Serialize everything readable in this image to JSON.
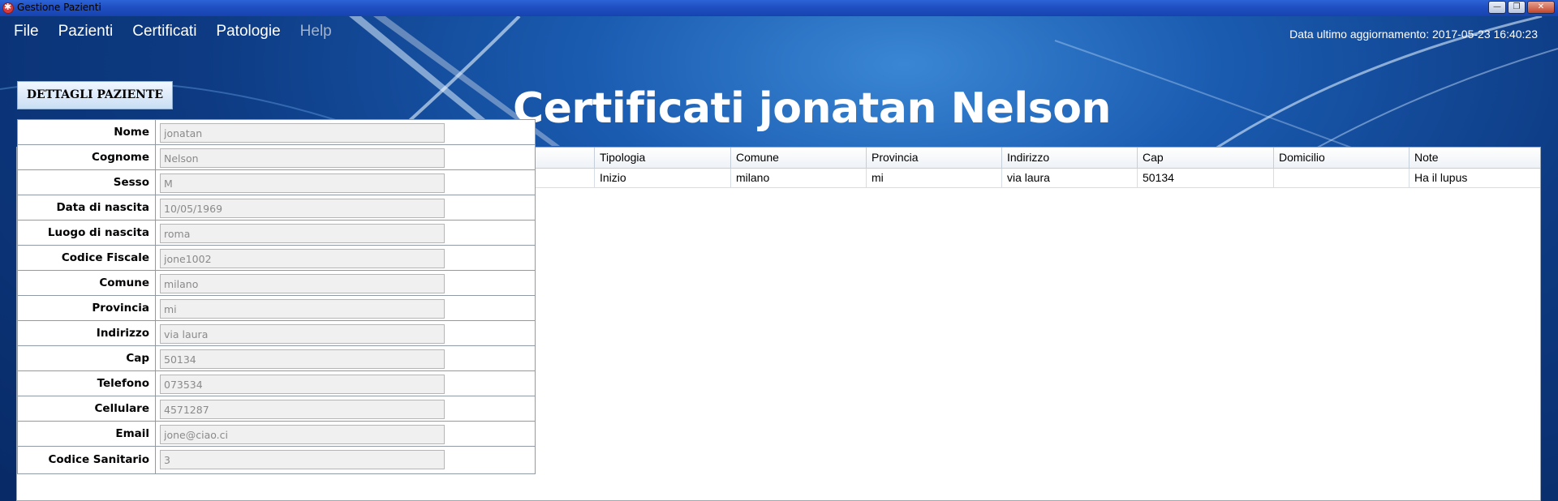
{
  "window": {
    "title": "Gestione Pazienti",
    "buttons": [
      "—",
      "❐",
      "✕"
    ]
  },
  "menu": {
    "items": [
      "File",
      "Pazienti",
      "Certificati",
      "Patologie",
      "Help"
    ]
  },
  "header": {
    "update_label": "Data ultimo aggiornamento: 2017-05-23 16:40:23",
    "page_title": "Certificati jonatan Nelson"
  },
  "details_button": "DETTAGLI PAZIENTE",
  "patient_form": {
    "fields": [
      {
        "label": "Nome",
        "value": "jonatan"
      },
      {
        "label": "Cognome",
        "value": "Nelson"
      },
      {
        "label": "Sesso",
        "value": "M"
      },
      {
        "label": "Data di nascita",
        "value": "10/05/1969"
      },
      {
        "label": "Luogo di nascita",
        "value": "roma"
      },
      {
        "label": "Codice Fiscale",
        "value": "jone1002"
      },
      {
        "label": "Comune",
        "value": "milano"
      },
      {
        "label": "Provincia",
        "value": "mi"
      },
      {
        "label": "Indirizzo",
        "value": "via laura"
      },
      {
        "label": "Cap",
        "value": "50134"
      },
      {
        "label": "Telefono",
        "value": "073534"
      },
      {
        "label": "Cellulare",
        "value": "4571287"
      },
      {
        "label": "Email",
        "value": "jone@ciao.ci"
      },
      {
        "label": "Codice Sanitario",
        "value": "3"
      }
    ]
  },
  "cert_table": {
    "columns": [
      "Tipologia",
      "Comune",
      "Provincia",
      "Indirizzo",
      "Cap",
      "Domicilio",
      "Note"
    ],
    "rows": [
      [
        "Inizio",
        "milano",
        "mi",
        "via laura",
        "50134",
        "",
        "Ha il lupus"
      ]
    ]
  }
}
